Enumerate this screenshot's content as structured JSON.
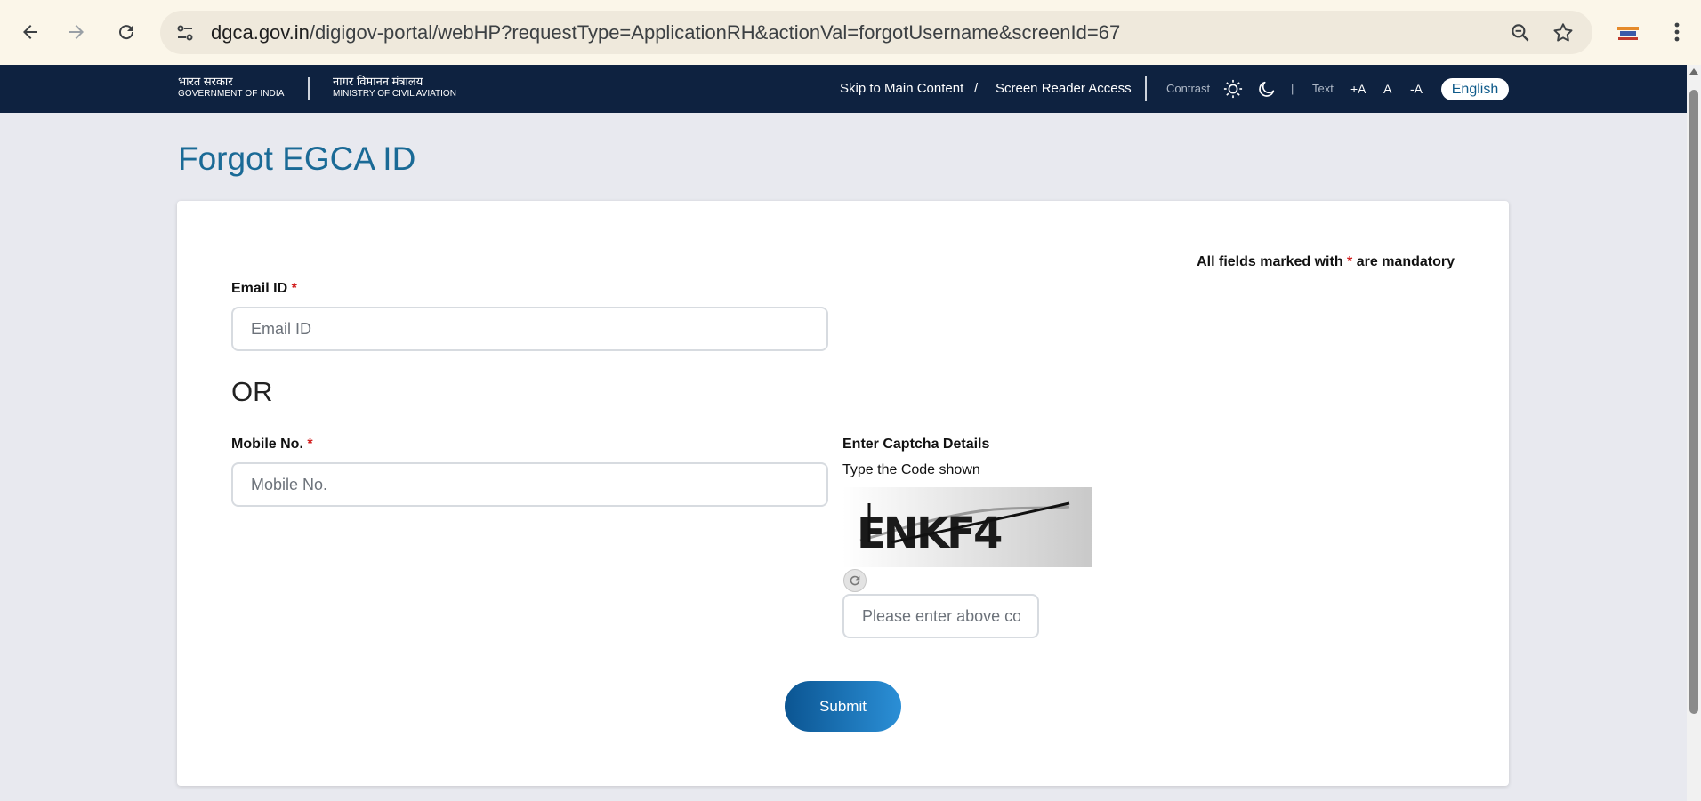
{
  "browser": {
    "url_host": "dgca.gov.in",
    "url_path": "/digigov-portal/webHP?requestType=ApplicationRH&actionVal=forgotUsername&screenId=67",
    "icons": [
      "back-icon",
      "forward-icon",
      "reload-icon",
      "site-info-icon",
      "zoom-icon",
      "bookmark-star-icon",
      "extension-emblem-icon",
      "browser-menu-icon"
    ]
  },
  "header": {
    "gov_hindi": "भारत सरकार",
    "gov_english": "GOVERNMENT OF INDIA",
    "ministry_hindi": "नागर विमानन मंत्रालय",
    "ministry_english": "MINISTRY OF CIVIL AVIATION",
    "skip_link": "Skip to Main Content",
    "link_separator": "/",
    "screen_reader": "Screen Reader Access",
    "contrast_label": "Contrast",
    "pipe": "|",
    "text_label": "Text",
    "text_increase": "+A",
    "text_normal": "A",
    "text_decrease": "-A",
    "language": "English",
    "colors": {
      "background": "#0e2240"
    }
  },
  "page": {
    "title": "Forgot EGCA ID",
    "mandatory_prefix": "All fields marked with ",
    "mandatory_star": "*",
    "mandatory_suffix": " are mandatory",
    "email": {
      "label": "Email ID",
      "required": "*",
      "placeholder": "Email ID",
      "value": ""
    },
    "or_text": "OR",
    "mobile": {
      "label": "Mobile No.",
      "required": "*",
      "placeholder": "Mobile No.",
      "value": ""
    },
    "captcha": {
      "title": "Enter Captcha Details",
      "help": "Type the Code shown",
      "image_text": "ENKF4",
      "placeholder": "Please enter above code",
      "value": ""
    },
    "submit_label": "Submit",
    "colors": {
      "title": "#1a6a96",
      "required": "#d21f1f",
      "submit_start": "#0b5592",
      "submit_end": "#2b8fd6"
    }
  }
}
